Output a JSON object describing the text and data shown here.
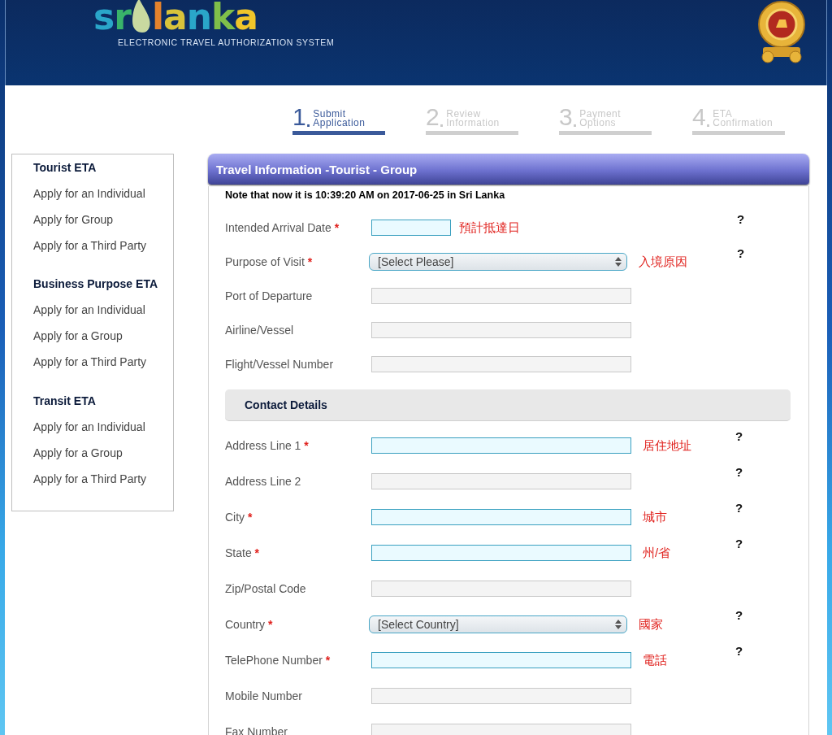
{
  "header": {
    "logo_start": "sr",
    "logo_end": "lanka",
    "tagline": "ELECTRONIC TRAVEL AUTHORIZATION SYSTEM"
  },
  "steps": [
    {
      "number": "1",
      "dot": ".",
      "line1": "Submit",
      "line2": "Application",
      "selected": true
    },
    {
      "number": "2",
      "dot": ".",
      "line1": "Review",
      "line2": "Information",
      "selected": false
    },
    {
      "number": "3",
      "dot": ".",
      "line1": "Payment",
      "line2": "Options",
      "selected": false
    },
    {
      "number": "4",
      "dot": ".",
      "line1": "ETA",
      "line2": "Confirmation",
      "selected": false
    }
  ],
  "sidebar": [
    {
      "heading": "Tourist ETA",
      "items": [
        "Apply for an Individual",
        "Apply for Group",
        "Apply for a Third Party"
      ]
    },
    {
      "heading": "Business Purpose ETA",
      "items": [
        "Apply for an Individual",
        "Apply for a Group",
        "Apply for a Third Party"
      ]
    },
    {
      "heading": "Transit ETA",
      "items": [
        "Apply for an Individual",
        "Apply for a Group",
        "Apply for a Third Party"
      ]
    }
  ],
  "panel": {
    "title": "Travel Information -Tourist - Group",
    "note": "Note that now it is 10:39:20 AM on 2017-06-25 in Sri Lanka"
  },
  "travel_fields": [
    {
      "label": "Intended Arrival Date",
      "kind": "date",
      "required_mark": "*",
      "annotation": "預計抵達日",
      "help": "?"
    },
    {
      "label": "Purpose of Visit",
      "kind": "select",
      "required_mark": "*",
      "value": "[Select Please]",
      "annotation": "入境原因",
      "help": "?"
    },
    {
      "label": "Port of Departure",
      "kind": "text"
    },
    {
      "label": "Airline/Vessel",
      "kind": "text"
    },
    {
      "label": "Flight/Vessel Number",
      "kind": "text"
    }
  ],
  "contact_section": {
    "title": "Contact Details"
  },
  "contact_fields": [
    {
      "label": "Address Line 1",
      "kind": "text",
      "required_mark": "*",
      "annotation": "居住地址",
      "help": "?"
    },
    {
      "label": "Address Line 2",
      "kind": "text",
      "help": "?"
    },
    {
      "label": "City",
      "kind": "text",
      "required_mark": "*",
      "annotation": "城市",
      "help": "?"
    },
    {
      "label": "State",
      "kind": "text",
      "required_mark": "*",
      "annotation": "州/省",
      "help": "?"
    },
    {
      "label": "Zip/Postal Code",
      "kind": "text"
    },
    {
      "label": "Country",
      "kind": "select",
      "required_mark": "*",
      "value": "[Select Country]",
      "annotation": "國家",
      "help": "?"
    },
    {
      "label": "TelePhone Number",
      "kind": "text",
      "required_mark": "*",
      "annotation": "電話",
      "help": "?"
    },
    {
      "label": "Mobile Number",
      "kind": "text"
    },
    {
      "label": "Fax Number",
      "kind": "text"
    }
  ]
}
